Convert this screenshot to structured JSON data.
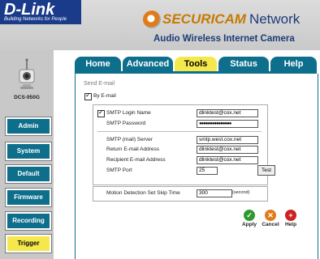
{
  "header": {
    "logo": "D-Link",
    "tagline": "Building Networks for People",
    "brand_securi": "SECURICAM",
    "brand_network": "Network",
    "subtitle": "Audio Wireless Internet Camera"
  },
  "device": {
    "model": "DCS-950G"
  },
  "sidebar": {
    "items": [
      {
        "label": "Admin",
        "active": false
      },
      {
        "label": "System",
        "active": false
      },
      {
        "label": "Default",
        "active": false
      },
      {
        "label": "Firmware",
        "active": false
      },
      {
        "label": "Recording",
        "active": false
      },
      {
        "label": "Trigger",
        "active": true
      }
    ]
  },
  "tabs": [
    {
      "label": "Home",
      "active": false
    },
    {
      "label": "Advanced",
      "active": false
    },
    {
      "label": "Tools",
      "active": true
    },
    {
      "label": "Status",
      "active": false
    },
    {
      "label": "Help",
      "active": false
    }
  ],
  "form": {
    "section_title": "Send E-mail",
    "by_email_label": "By E-mail",
    "by_email_checked": true,
    "smtp_login_label": "SMTP Login Name",
    "smtp_login_checked": true,
    "smtp_login_value": "dlinktest@cox.net",
    "smtp_password_label": "SMTP Password",
    "smtp_password_value": "●●●●●●●●●●●●●●●",
    "smtp_server_label": "SMTP (mail) Server",
    "smtp_server_value": "smtp.west.cox.net",
    "return_email_label": "Return E-mail Address",
    "return_email_value": "dlinktest@cox.net",
    "recipient_email_label": "Recipient E-mail Address",
    "recipient_email_value": "dlinktest@cox.net",
    "smtp_port_label": "SMTP Port",
    "smtp_port_value": "25",
    "test_button": "Test",
    "skip_time_label": "Motion Detection Set Skip Time",
    "skip_time_value": "300",
    "skip_time_unit": "(second)"
  },
  "actions": {
    "apply": "Apply",
    "cancel": "Cancel",
    "help": "Help"
  },
  "colors": {
    "nav_teal": "#0d6f8c",
    "active_yellow": "#f5e84c",
    "apply_green": "#2e9a2e",
    "cancel_orange": "#e07b1a",
    "help_red": "#cc2222"
  }
}
